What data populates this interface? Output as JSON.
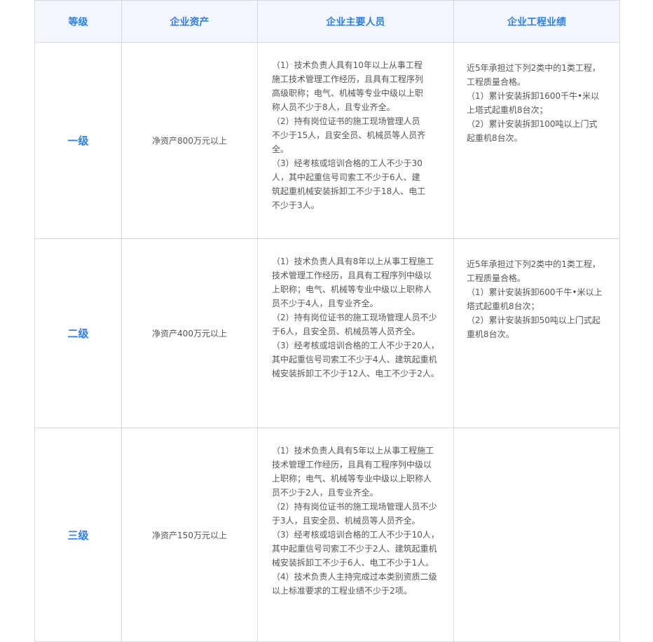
{
  "table": {
    "headers": [
      "等级",
      "企业资产",
      "企业主要人员",
      "企业工程业绩"
    ],
    "rows": [
      {
        "grade": "一级",
        "asset": "净资产800万元以上",
        "personnel": [
          "（1）技术负责人具有10年以上从事工程",
          "施工技术管理工作经历，且具有工程序列",
          "高级职称；电气、机械等专业中级以上职",
          "称人员不少于8人，且专业齐全。",
          "（2）持有岗位证书的施工现场管理人员",
          "不少于15人，且安全员、机械员等人员齐",
          "全。",
          "（3）经考核或培训合格的工人不少于30",
          "人，其中起重信号司索工不少于6人、建",
          "筑起重机械安装拆卸工不少于18人、电工",
          "不少于3人。"
        ],
        "performance": [
          "近5年承担过下列2类中的1类工程，",
          "工程质量合格。",
          "（1）累计安装拆卸1600千牛•米以",
          "上塔式起重机8台次；",
          "（2）累计安装拆卸100吨以上门式",
          "起重机8台次。"
        ]
      },
      {
        "grade": "二级",
        "asset": "净资产400万元以上",
        "personnel": [
          "（1）技术负责人具有8年以上从事工程施工",
          "技术管理工作经历，且具有工程序列中级以",
          "上职称；电气、机械等专业中级以上职称人",
          "员不少于4人，且专业齐全。",
          "（2）持有岗位证书的施工现场管理人员不少",
          "于6人，且安全员、机械员等人员齐全。",
          "（3）经考核或培训合格的工人不少于20人，",
          "其中起重信号司索工不少于4人、建筑起重机",
          "械安装拆卸工不少于12人、电工不少于2人。"
        ],
        "performance": [
          "近5年承担过下列2类中的1类工程，",
          "工程质量合格。",
          "（1）累计安装拆卸600千牛•米以上",
          "塔式起重机8台次；",
          "（2）累计安装拆卸50吨以上门式起",
          "重机8台次。"
        ]
      },
      {
        "grade": "三级",
        "asset": "净资产150万元以上",
        "personnel": [
          "（1）技术负责人具有5年以上从事工程施工",
          "技术管理工作经历，且具有工程序列中级以",
          "上职称；电气、机械等专业中级以上职称人",
          "员不少于2人，且专业齐全。",
          "（2）持有岗位证书的施工现场管理人员不少",
          "于3人，且安全员、机械员等人员齐全。",
          "（3）经考核或培训合格的工人不少于10人，",
          "其中起重信号司索工不少于2人、建筑起重机",
          "械安装拆卸工不少于6人、电工不少于1人。",
          "（4）技术负责人主持完成过本类别资质二级",
          "以上标准要求的工程业绩不少于2项。"
        ],
        "performance": []
      }
    ]
  }
}
